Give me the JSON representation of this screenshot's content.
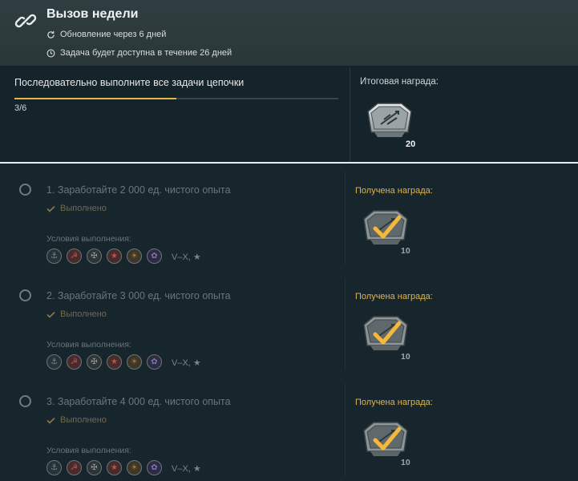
{
  "header": {
    "title": "Вызов недели",
    "update_text": "Обновление через 6 дней",
    "availability_text": "Задача будет доступна в течение 26 дней"
  },
  "summary": {
    "task_text": "Последовательно выполните все задачи цепочки",
    "progress_text": "3/6",
    "progress_fraction": 0.5,
    "final_reward_label": "Итоговая награда:",
    "final_reward_quantity": "20"
  },
  "steps": [
    {
      "title": "1. Заработайте 2 000 ед. чистого опыта",
      "status": "Выполнено",
      "conditions_label": "Условия выполнения:",
      "tier_text": "V–X, ★",
      "reward_label": "Получена награда:",
      "reward_quantity": "10"
    },
    {
      "title": "2. Заработайте 3 000 ед. чистого опыта",
      "status": "Выполнено",
      "conditions_label": "Условия выполнения:",
      "tier_text": "V–X, ★",
      "reward_label": "Получена награда:",
      "reward_quantity": "10"
    },
    {
      "title": "3. Заработайте 4 000 ед. чистого опыта",
      "status": "Выполнено",
      "conditions_label": "Условия выполнения:",
      "tier_text": "V–X, ★",
      "reward_label": "Получена награда:",
      "reward_quantity": "10"
    }
  ],
  "icons": {
    "header": "chain-link-icon",
    "update": "refresh-icon",
    "availability": "clock-icon",
    "completed": "checkmark-icon",
    "reward": "container-crate-icon",
    "nations": [
      "usa-flag-icon",
      "ussr-flag-icon",
      "germany-flag-icon",
      "china-flag-icon",
      "japan-flag-icon",
      "france-flag-icon"
    ]
  },
  "colors": {
    "accent_gold": "#e9b442",
    "header_bg": "#2f3e40",
    "panel_bg": "#15232a",
    "step_bg": "#17252c"
  }
}
